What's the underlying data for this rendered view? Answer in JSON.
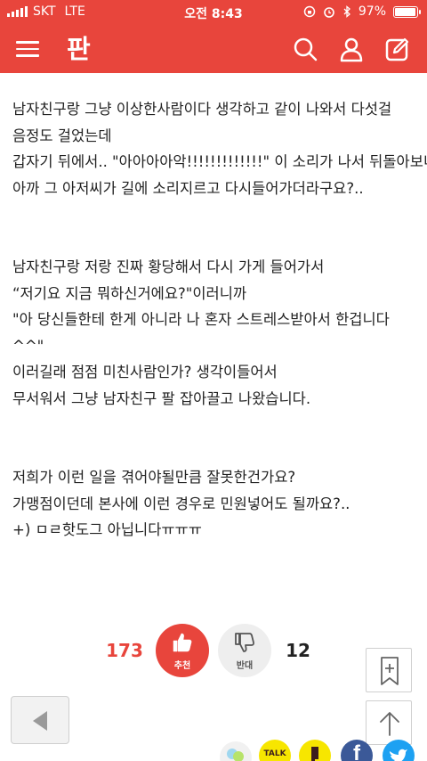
{
  "status_bar": {
    "carrier": "SKT",
    "network": "LTE",
    "time": "오전 8:43",
    "battery": "97%",
    "battery_level": 0.97
  },
  "app_bar": {
    "logo": "판",
    "icons": [
      "menu-icon",
      "search-icon",
      "profile-icon",
      "write-icon"
    ]
  },
  "article": {
    "lines": [
      "남자친구랑 그냥 이상한사람이다 생각하고 같이 나와서 다섯걸",
      "음정도 걸었는데",
      "갑자기 뒤에서.. \"아아아아악!!!!!!!!!!!!!\" 이 소리가 나서 뒤돌아보니",
      "아까 그 아저씨가 길에 소리지르고 다시들어가더라구요?..",
      "",
      "",
      "남자친구랑 저랑 진짜 황당해서 다시 가게 들어가서",
      "“저기요 지금 뭐하신거에요?\"이러니까",
      "\"아 당신들한테 한게 아니라 나 혼자 스트레스받아서 한겁니다",
      "^^\"",
      "이러길래 점점 미친사람인가? 생각이들어서",
      "무서워서 그냥 남자친구 팔 잡아끌고 나왔습니다.",
      "",
      "",
      "저희가 이런 일을 겪어야될만큼 잘못한건가요?",
      "가맹점이던데 본사에 이런 경우로 민원넣어도 될까요?..",
      "+) ㅁㄹ핫도그 아닙니다ㅠㅠㅠ"
    ]
  },
  "vote": {
    "up_count": "173",
    "up_label": "추천",
    "down_count": "12",
    "down_label": "반대"
  },
  "floating": {
    "bookmark_icon": "bookmark-add-icon",
    "top_icon": "arrow-up-icon",
    "back_icon": "back-arrow-icon"
  },
  "share": {
    "talk_label": "TALK",
    "facebook_label": "f"
  },
  "colors": {
    "brand": "#e8453c",
    "kakao": "#f7e600",
    "facebook": "#3b5998",
    "twitter": "#1da1f2"
  }
}
